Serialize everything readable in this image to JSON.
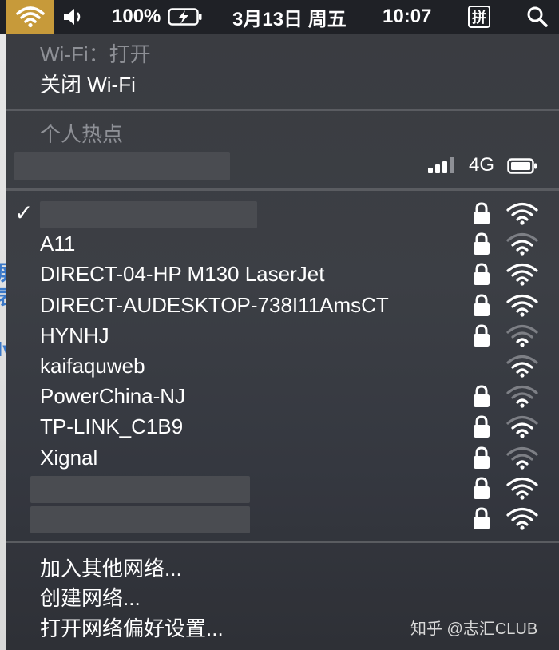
{
  "menubar": {
    "wifi_icon": "wifi-icon",
    "volume_icon": "speaker-icon",
    "battery_percent": "100%",
    "battery_icon": "battery-charging-icon",
    "date": "3月13日 周五",
    "time": "10:07",
    "ime_label": "拼",
    "search_icon": "search-icon"
  },
  "wifi_section": {
    "status": "Wi-Fi：打开",
    "toggle_label": "关闭 Wi-Fi"
  },
  "hotspot_section": {
    "title": "个人热点",
    "signal_icon": "cellular-signal-icon",
    "network_type": "4G",
    "battery_icon": "battery-full-icon"
  },
  "networks": [
    {
      "name": "",
      "connected": true,
      "locked": true,
      "signal": 3
    },
    {
      "name": "A11",
      "connected": false,
      "locked": true,
      "signal": 2
    },
    {
      "name": "DIRECT-04-HP M130 LaserJet",
      "connected": false,
      "locked": true,
      "signal": 3
    },
    {
      "name": "DIRECT-AUDESKTOP-738I11AmsCT",
      "connected": false,
      "locked": true,
      "signal": 3
    },
    {
      "name": "HYNHJ",
      "connected": false,
      "locked": true,
      "signal": 1
    },
    {
      "name": "kaifaquweb",
      "connected": false,
      "locked": false,
      "signal": 2
    },
    {
      "name": "PowerChina-NJ",
      "connected": false,
      "locked": true,
      "signal": 1
    },
    {
      "name": "TP-LINK_C1B9",
      "connected": false,
      "locked": true,
      "signal": 2
    },
    {
      "name": "Xignal",
      "connected": false,
      "locked": true,
      "signal": 1
    },
    {
      "name": "",
      "connected": false,
      "locked": true,
      "signal": 3
    },
    {
      "name": "",
      "connected": false,
      "locked": true,
      "signal": 3
    }
  ],
  "footer": {
    "join_other": "加入其他网络...",
    "create_network": "创建网络...",
    "open_preferences": "打开网络偏好设置..."
  },
  "watermark": "知乎 @志汇CLUB",
  "colors": {
    "highlight": "#c79a3a",
    "menubar_bg": "#1f2126",
    "panel_bg": "#3b3d42",
    "dim_text": "#8e9096"
  }
}
